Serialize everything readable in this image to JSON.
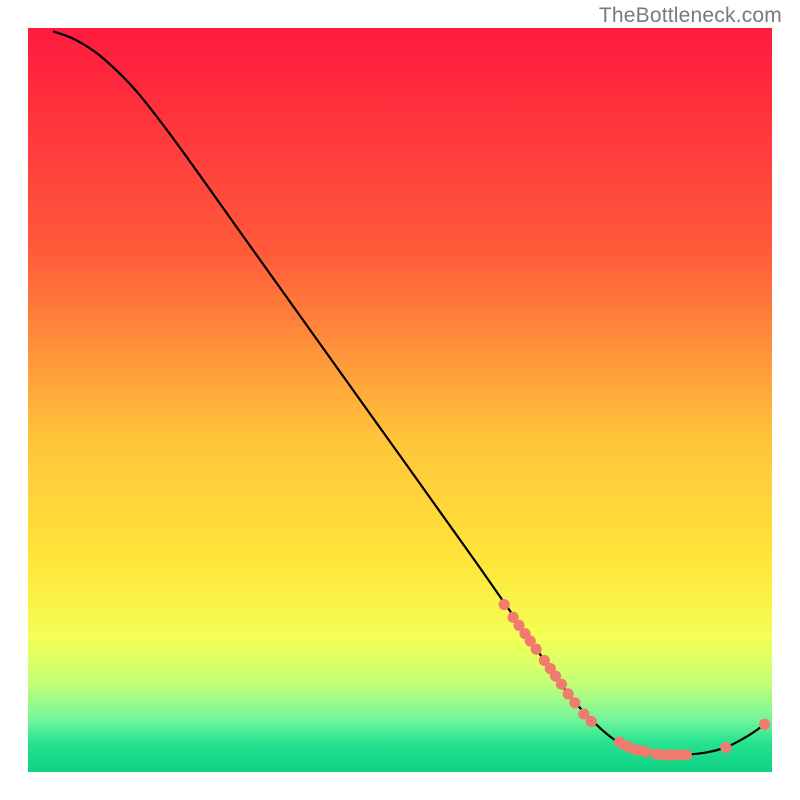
{
  "watermark": "TheBottleneck.com",
  "chart_data": {
    "type": "line",
    "title": "",
    "xlabel": "",
    "ylabel": "",
    "xlim": [
      0,
      100
    ],
    "ylim": [
      0,
      100
    ],
    "gradient_stops": [
      {
        "offset": 0,
        "color": "#ff1a3e"
      },
      {
        "offset": 30,
        "color": "#ff5a3a"
      },
      {
        "offset": 55,
        "color": "#ffc43a"
      },
      {
        "offset": 72,
        "color": "#ffe63a"
      },
      {
        "offset": 82,
        "color": "#f4ff55"
      },
      {
        "offset": 88,
        "color": "#c6ff77"
      },
      {
        "offset": 93,
        "color": "#71f59a"
      },
      {
        "offset": 96,
        "color": "#27e38f"
      },
      {
        "offset": 100,
        "color": "#0fd184"
      }
    ],
    "curve": [
      {
        "x": 3.5,
        "y": 99.5
      },
      {
        "x": 6.0,
        "y": 98.6
      },
      {
        "x": 9.0,
        "y": 96.8
      },
      {
        "x": 12.0,
        "y": 94.2
      },
      {
        "x": 15.0,
        "y": 91.0
      },
      {
        "x": 20.0,
        "y": 84.5
      },
      {
        "x": 30.0,
        "y": 70.5
      },
      {
        "x": 45.0,
        "y": 49.5
      },
      {
        "x": 60.0,
        "y": 28.5
      },
      {
        "x": 68.0,
        "y": 17.0
      },
      {
        "x": 73.0,
        "y": 10.0
      },
      {
        "x": 77.0,
        "y": 5.8
      },
      {
        "x": 80.0,
        "y": 3.6
      },
      {
        "x": 83.0,
        "y": 2.6
      },
      {
        "x": 87.0,
        "y": 2.3
      },
      {
        "x": 91.0,
        "y": 2.6
      },
      {
        "x": 94.0,
        "y": 3.4
      },
      {
        "x": 97.0,
        "y": 5.0
      },
      {
        "x": 99.0,
        "y": 6.4
      }
    ],
    "dots": [
      {
        "x": 64.0,
        "y": 22.5
      },
      {
        "x": 65.2,
        "y": 20.8
      },
      {
        "x": 66.0,
        "y": 19.7
      },
      {
        "x": 66.8,
        "y": 18.6
      },
      {
        "x": 67.5,
        "y": 17.6
      },
      {
        "x": 68.3,
        "y": 16.5
      },
      {
        "x": 69.4,
        "y": 15.0
      },
      {
        "x": 70.2,
        "y": 13.9
      },
      {
        "x": 70.9,
        "y": 12.9
      },
      {
        "x": 71.7,
        "y": 11.8
      },
      {
        "x": 72.6,
        "y": 10.5
      },
      {
        "x": 73.5,
        "y": 9.3
      },
      {
        "x": 74.7,
        "y": 7.8
      },
      {
        "x": 75.7,
        "y": 6.8
      },
      {
        "x": 79.5,
        "y": 4.0
      },
      {
        "x": 80.4,
        "y": 3.5
      },
      {
        "x": 81.3,
        "y": 3.1
      },
      {
        "x": 82.2,
        "y": 2.9
      },
      {
        "x": 83.1,
        "y": 2.7
      },
      {
        "x": 84.5,
        "y": 2.4
      },
      {
        "x": 85.5,
        "y": 2.3
      },
      {
        "x": 86.4,
        "y": 2.3
      },
      {
        "x": 87.4,
        "y": 2.3
      },
      {
        "x": 88.5,
        "y": 2.3
      },
      {
        "x": 93.8,
        "y": 3.3
      },
      {
        "x": 99.0,
        "y": 6.4
      }
    ],
    "dot_color": "#f17b6e",
    "dot_radius_pct": 0.75
  }
}
